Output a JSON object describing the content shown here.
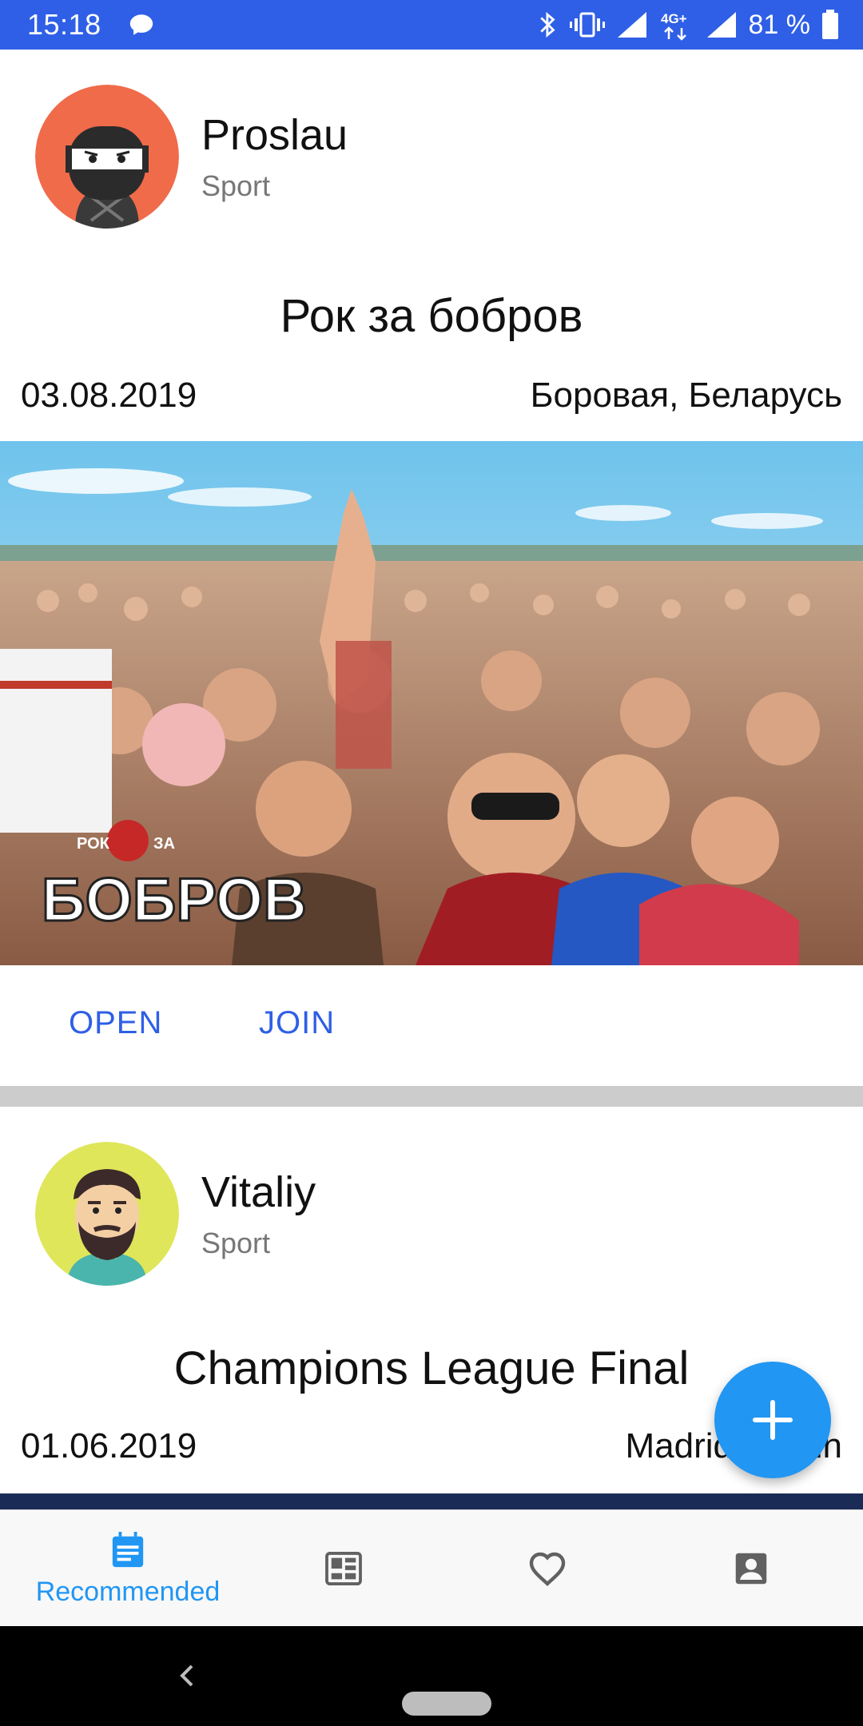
{
  "status_bar": {
    "time": "15:18",
    "battery": "81 %",
    "network": "4G+",
    "icons": [
      "message-icon",
      "bluetooth-icon",
      "vibrate-icon",
      "signal-icon",
      "network-4g-icon",
      "signal-icon",
      "battery-icon"
    ]
  },
  "feed": {
    "events": [
      {
        "author": "Proslau",
        "category": "Sport",
        "avatar": "ninja-avatar",
        "title": "Рок за бобров",
        "date": "03.08.2019",
        "place": "Боровая, Беларусь",
        "image": "concert-crowd-photo",
        "image_logo_small": "РОК",
        "image_logo_small_2": "ЗА",
        "image_logo_big": "БОБРОВ",
        "actions": {
          "open": "OPEN",
          "join": "JOIN"
        }
      },
      {
        "author": "Vitaliy",
        "category": "Sport",
        "avatar": "bearded-man-avatar",
        "title": "Champions League Final",
        "date": "01.06.2019",
        "place": "Madrid, Spain"
      }
    ]
  },
  "fab": {
    "icon": "plus-icon"
  },
  "bottom_nav": {
    "items": [
      {
        "label": "Recommended",
        "icon": "calendar-icon",
        "active": true
      },
      {
        "label": "",
        "icon": "news-icon",
        "active": false
      },
      {
        "label": "",
        "icon": "heart-icon",
        "active": false
      },
      {
        "label": "",
        "icon": "account-icon",
        "active": false
      }
    ]
  },
  "colors": {
    "status_bar": "#2f5fe6",
    "accent": "#2196f3",
    "action_text": "#2f5fe6",
    "divider": "#cccccc",
    "nav_inactive": "#616161"
  }
}
